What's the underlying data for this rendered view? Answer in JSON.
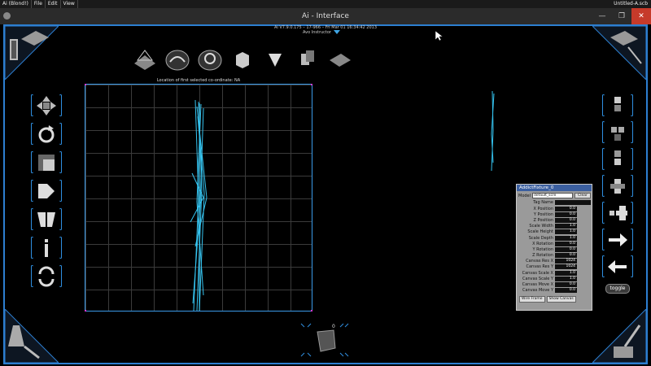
{
  "menubar": {
    "items": [
      "Ai (Blond!)",
      "File",
      "Edit",
      "View"
    ],
    "right_title": "Untitled-A.scb"
  },
  "window": {
    "title": "Ai - Interface",
    "version_line": "Ai V7.9.0.175 – 17-966 – Fri Mar 01 16:34:42 2013",
    "instructor_label": "Avo Instructor"
  },
  "viewport": {
    "label": "Location of first selected co-ordinate: NA"
  },
  "icons": {
    "top_toolbar": [
      "lasso-icon",
      "stage-icon",
      "sphere-icon",
      "cube-icon",
      "cone-icon",
      "duplicate-icon",
      "plane-icon"
    ],
    "left_tools": [
      "move-icon",
      "rotate-icon",
      "scale-icon",
      "extrude-icon",
      "mirror-icon",
      "info-icon",
      "cycle-icon"
    ],
    "right_tools": [
      "tile-icon",
      "tile-alt-icon",
      "stack-icon",
      "stack-alt-icon",
      "split-icon",
      "arrow-right-icon",
      "arrow-left-icon"
    ]
  },
  "panel": {
    "title": "AddictFixture_0",
    "model_label": "Model",
    "model_value": "default_scre",
    "clear_label": "Clear",
    "tag_name_label": "Tag Name",
    "fields": [
      {
        "label": "X Position",
        "value": "0.0"
      },
      {
        "label": "Y Position",
        "value": "0.0"
      },
      {
        "label": "Z Position",
        "value": "0.0"
      },
      {
        "label": "Scale Width",
        "value": "1.0"
      },
      {
        "label": "Scale Height",
        "value": "1.0"
      },
      {
        "label": "Scale Depth",
        "value": "1.0"
      },
      {
        "label": "X Rotation",
        "value": "0.0"
      },
      {
        "label": "Y Rotation",
        "value": "0.0"
      },
      {
        "label": "Z Rotation",
        "value": "0.0"
      },
      {
        "label": "Canvas Res X",
        "value": "1024"
      },
      {
        "label": "Canvas Res Y",
        "value": "1024"
      },
      {
        "label": "Canvas Scale X",
        "value": "1.0"
      },
      {
        "label": "Canvas Scale Y",
        "value": "1.0"
      },
      {
        "label": "Canvas Move X",
        "value": "0.0"
      },
      {
        "label": "Canvas Move Y",
        "value": "0.0"
      }
    ],
    "wire_frame_label": "Wire Frame",
    "show_canvas_label": "Show Canvas"
  },
  "toggle_label": "toggle",
  "bottom_widget": {
    "index": "0"
  },
  "colors": {
    "accent": "#2d7fd1",
    "wire": "#35c4f0",
    "grid": "#3b3b3b"
  }
}
